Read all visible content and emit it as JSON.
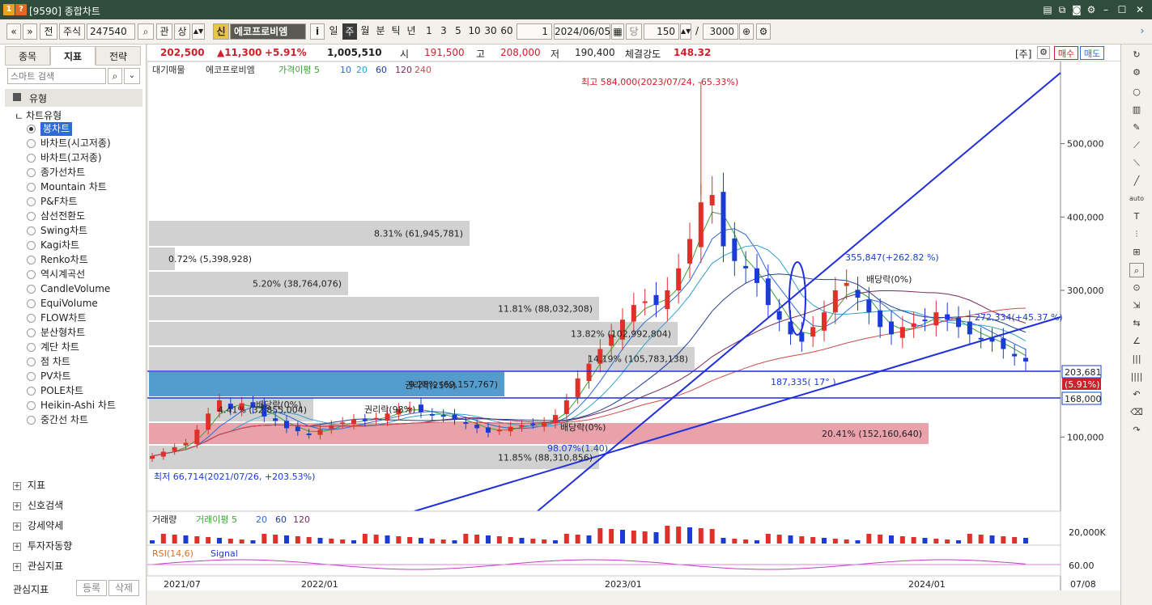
{
  "window": {
    "title": "[9590] 종합차트",
    "num1": "1",
    "num2": "?"
  },
  "toolbar": {
    "prev": "«",
    "down": "»",
    "jeon": "전",
    "market": "주식",
    "code": "247540",
    "gwan": "관",
    "sang": "상",
    "sin": "신",
    "stock_name": "에코프로비엠",
    "info": "i",
    "periods": [
      "일",
      "주",
      "월",
      "분",
      "틱",
      "년"
    ],
    "intervals": [
      "1",
      "3",
      "5",
      "10",
      "30",
      "60"
    ],
    "count": "1",
    "date": "2024/06/05",
    "dang": "당",
    "view_count": "150",
    "slash": "/",
    "total_count": "3000"
  },
  "left": {
    "tabs": [
      "종목",
      "지표",
      "전략"
    ],
    "search_placeholder": "스마트 검색",
    "type_header": "유형",
    "chart_type_label": "차트유형",
    "chart_types": [
      "봉차트",
      "바차트(시고저종)",
      "바차트(고저종)",
      "종가선차트",
      "Mountain 차트",
      "P&F차트",
      "삼선전환도",
      "Swing차트",
      "Kagi차트",
      "Renko차트",
      "역시계곡선",
      "CandleVolume",
      "EquiVolume",
      "FLOW차트",
      "분산형차트",
      "계단 차트",
      "점 차트",
      "PV차트",
      "POLE차트",
      "Heikin-Ashi 차트",
      "중간선 차트"
    ],
    "sections": [
      "지표",
      "신호검색",
      "강세약세",
      "투자자동향",
      "관심지표"
    ],
    "bottom": {
      "label": "관심지표",
      "add": "등록",
      "del": "삭제"
    }
  },
  "pricebar": {
    "price": "202,500",
    "change": "▲11,300",
    "pct": "+5.91%",
    "volume": "1,005,510",
    "open_label": "시",
    "open": "191,500",
    "high_label": "고",
    "high": "208,000",
    "low_label": "저",
    "low": "190,400",
    "strength_label": "체결강도",
    "strength": "148.32",
    "week_label": "[주]",
    "buy": "매수",
    "sell": "매도"
  },
  "legend": {
    "vp": "대기매물",
    "name": "에코프로비엠",
    "ma_label": "가격이평 5",
    "ma": [
      "10",
      "20",
      "60",
      "120",
      "240"
    ]
  },
  "colors": {
    "ma5": "#3aa335",
    "ma10": "#2d6bd6",
    "ma20": "#2fa0c8",
    "ma60": "#263f9a",
    "ma120": "#7a2a5c",
    "ma240": "#d04a4a",
    "up": "#e0302a",
    "down": "#1a3bd6",
    "vp": "#cfcfcf",
    "vp_blue": "#4b97cb",
    "vp_red": "#e89ca5",
    "trend": "#1f2fdc"
  },
  "chart_data": {
    "type": "candlestick",
    "x_ticks": [
      "2021/07",
      "2022/01",
      "2023/01",
      "2024/01",
      "07/08"
    ],
    "y_ticks": [
      "500,000",
      "400,000",
      "300,000",
      "100,000"
    ],
    "ylim": [
      0,
      590000
    ],
    "high_annot": "최고 584,000(2023/07/24, -65.33%)",
    "low_annot": "최저 66,714(2021/07/26, +203.53%)",
    "profile": [
      {
        "label": "8.31% (61,945,781)",
        "frac": 0.37,
        "color": "gray"
      },
      {
        "label": "0.72% (5,398,928)",
        "frac": 0.03,
        "color": "gray"
      },
      {
        "label": "5.20% (38,764,076)",
        "frac": 0.23,
        "color": "gray"
      },
      {
        "label": "11.81% (88,032,308)",
        "frac": 0.52,
        "color": "gray"
      },
      {
        "label": "13.82% (102,992,804)",
        "frac": 0.61,
        "color": "gray"
      },
      {
        "label": "14.19% (105,783,138)",
        "frac": 0.63,
        "color": "gray"
      },
      {
        "label": "9.28% (69,157,767)",
        "frac": 0.41,
        "color": "blue"
      },
      {
        "label": "4.41% (32,855,004)",
        "frac": 0.19,
        "color": "gray"
      },
      {
        "label": "20.41% (152,160,640)",
        "frac": 0.9,
        "color": "red"
      },
      {
        "label": "11.85% (88,310,856)",
        "frac": 0.52,
        "color": "gray"
      }
    ],
    "annotations": [
      "배당락(0%)",
      "권리락(98%)",
      "권리락(25%)",
      "배당락(0%)",
      "배당락(0%)",
      "98.07%(1.40)",
      "355,847(+262.82 %)",
      "272,334(+45.37 %)",
      "187,335( 17° )"
    ],
    "price_tags": {
      "current": "203,681",
      "pct": "(5.91%)",
      "line": "168,000"
    },
    "candles_close": [
      74,
      80,
      86,
      92,
      110,
      132,
      150,
      138,
      146,
      140,
      128,
      122,
      112,
      108,
      104,
      110,
      116,
      120,
      124,
      122,
      126,
      132,
      138,
      140,
      134,
      130,
      128,
      124,
      118,
      112,
      106,
      110,
      114,
      116,
      118,
      120,
      130,
      150,
      180,
      200,
      220,
      240,
      260,
      280,
      285,
      280,
      300,
      330,
      370,
      420,
      430,
      360,
      340,
      330,
      310,
      280,
      260,
      240,
      230,
      250,
      270,
      300,
      310,
      290,
      270,
      250,
      240,
      250,
      255,
      260,
      270,
      260,
      250,
      240,
      235,
      230,
      220,
      210,
      203
    ]
  },
  "volume_panel": {
    "label": "거래량",
    "ma_label": "거래이평 5",
    "ma": [
      "20",
      "60",
      "120"
    ],
    "tick": "20,000K"
  },
  "rsi_panel": {
    "label": "RSI(14,6)",
    "signal": "Signal",
    "tick": "60.00"
  }
}
